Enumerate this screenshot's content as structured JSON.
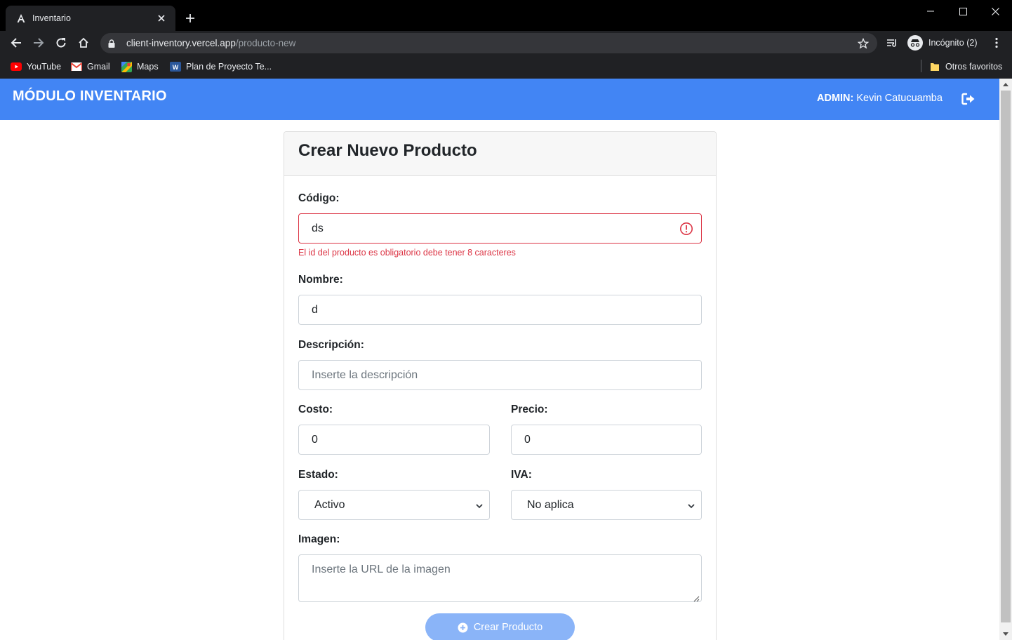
{
  "browser": {
    "tab_title": "Inventario",
    "url_host": "client-inventory.vercel.app",
    "url_path": "/producto-new",
    "profile_label": "Incógnito (2)",
    "bookmarks": [
      "YouTube",
      "Gmail",
      "Maps",
      "Plan de Proyecto Te..."
    ],
    "other_bookmarks": "Otros favoritos"
  },
  "navbar": {
    "brand": "MÓDULO INVENTARIO",
    "admin_label": "ADMIN:",
    "admin_name": "Kevin Catucuamba",
    "color": "#4285f4"
  },
  "form": {
    "title": "Crear Nuevo Producto",
    "codigo": {
      "label": "Código:",
      "value": "ds",
      "error": "El id del producto es obligatorio debe tener 8 caracteres"
    },
    "nombre": {
      "label": "Nombre:",
      "value": "d"
    },
    "descripcion": {
      "label": "Descripción:",
      "placeholder": "Inserte la descripción"
    },
    "costo": {
      "label": "Costo:",
      "value": "0"
    },
    "precio": {
      "label": "Precio:",
      "value": "0"
    },
    "estado": {
      "label": "Estado:",
      "selected": "Activo"
    },
    "iva": {
      "label": "IVA:",
      "selected": "No aplica"
    },
    "imagen": {
      "label": "Imagen:",
      "placeholder": "Inserte la URL de la imagen"
    },
    "submit_label": "Crear Producto"
  },
  "colors": {
    "error": "#dc3545",
    "submit_disabled": "#8ab4f8"
  }
}
